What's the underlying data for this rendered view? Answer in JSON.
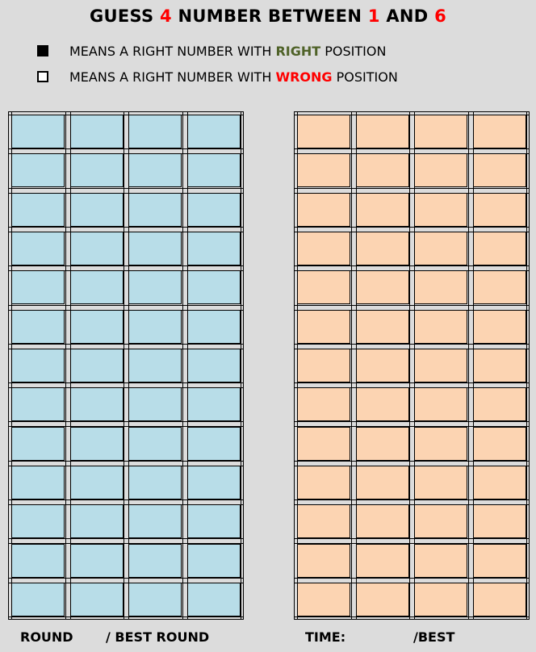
{
  "title": {
    "prefix": "GUESS ",
    "count": "4",
    "middle": " NUMBER BETWEEN ",
    "low": "1",
    "and": " AND ",
    "high": "6"
  },
  "legend": [
    {
      "icon": "filled-square-icon",
      "text_before": "MEANS A RIGHT NUMBER WITH ",
      "keyword": "RIGHT",
      "keyword_color": "#4f6228",
      "text_after": " POSITION"
    },
    {
      "icon": "hollow-square-icon",
      "text_before": "MEANS A RIGHT NUMBER WITH ",
      "keyword": "WRONG",
      "keyword_color": "#ff0000",
      "text_after": " POSITION"
    }
  ],
  "board": {
    "rows": 13,
    "columns": 4,
    "guess_fill": "#b8dde8",
    "feedback_fill": "#fcd4b2"
  },
  "footer": {
    "round_label": "ROUND",
    "best_round_label": "/ BEST ROUND",
    "time_label": "TIME:",
    "best_label": "/BEST"
  }
}
